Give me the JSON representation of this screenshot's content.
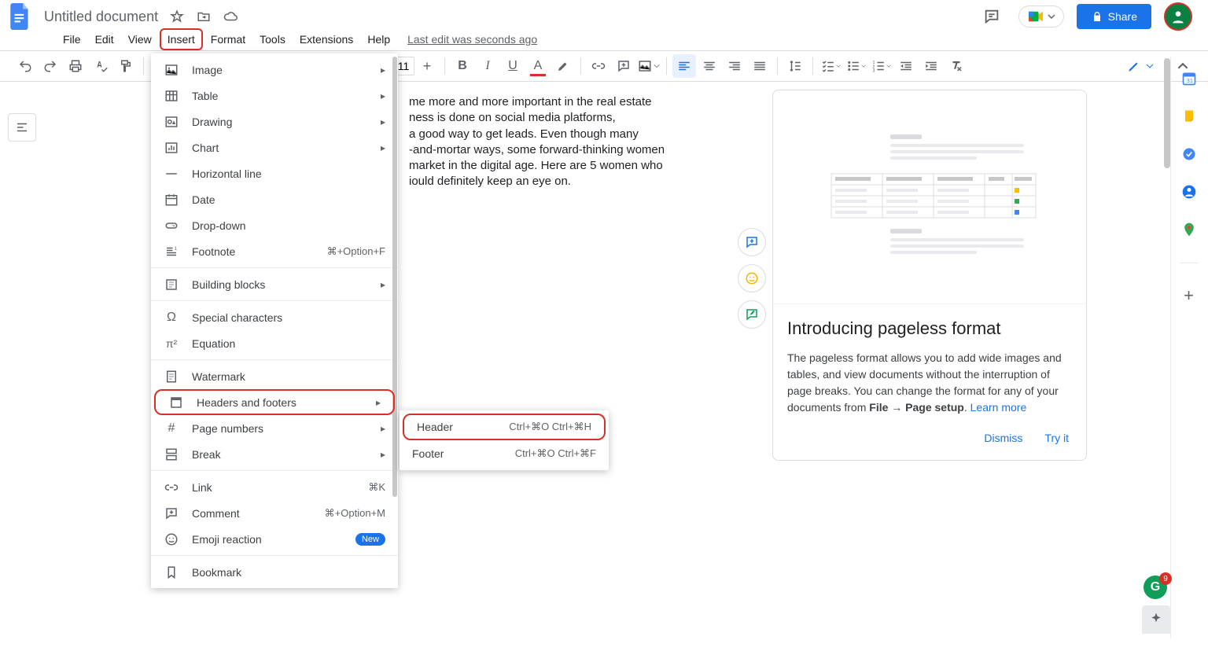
{
  "title": "Untitled document",
  "menus": {
    "file": "File",
    "edit": "Edit",
    "view": "View",
    "insert": "Insert",
    "format": "Format",
    "tools": "Tools",
    "extensions": "Extensions",
    "help": "Help"
  },
  "last_edit": "Last edit was seconds ago",
  "share": "Share",
  "font_size": "11",
  "insert_menu": {
    "image": "Image",
    "table": "Table",
    "drawing": "Drawing",
    "chart": "Chart",
    "horizontal_line": "Horizontal line",
    "date": "Date",
    "dropdown": "Drop-down",
    "footnote": "Footnote",
    "footnote_sc": "⌘+Option+F",
    "building_blocks": "Building blocks",
    "special_chars": "Special characters",
    "equation": "Equation",
    "watermark": "Watermark",
    "headers_footers": "Headers and footers",
    "page_numbers": "Page numbers",
    "break": "Break",
    "link": "Link",
    "link_sc": "⌘K",
    "comment": "Comment",
    "comment_sc": "⌘+Option+M",
    "emoji": "Emoji reaction",
    "new_badge": "New",
    "bookmark": "Bookmark"
  },
  "submenu": {
    "header": "Header",
    "header_sc": "Ctrl+⌘O Ctrl+⌘H",
    "footer": "Footer",
    "footer_sc": "Ctrl+⌘O Ctrl+⌘F"
  },
  "doc_text_1": "me more and more important in the real estate",
  "doc_text_2": "ness is done on social media platforms,",
  "doc_text_3": " a good way to get leads. Even though many",
  "doc_text_4": "-and-mortar ways, some forward-thinking women",
  "doc_text_5": " market in the digital age. Here are 5 women who",
  "doc_text_6": "iould definitely keep an eye on.",
  "pageless": {
    "title": "Introducing pageless format",
    "body1": "The pageless format allows you to add wide images and tables, and view documents without the interruption of page breaks. You can change the format for any of your documents from ",
    "body2": "File → Page setup",
    "body3": ". ",
    "learn": "Learn more",
    "dismiss": "Dismiss",
    "tryit": "Try it"
  },
  "grammarly_count": "9"
}
